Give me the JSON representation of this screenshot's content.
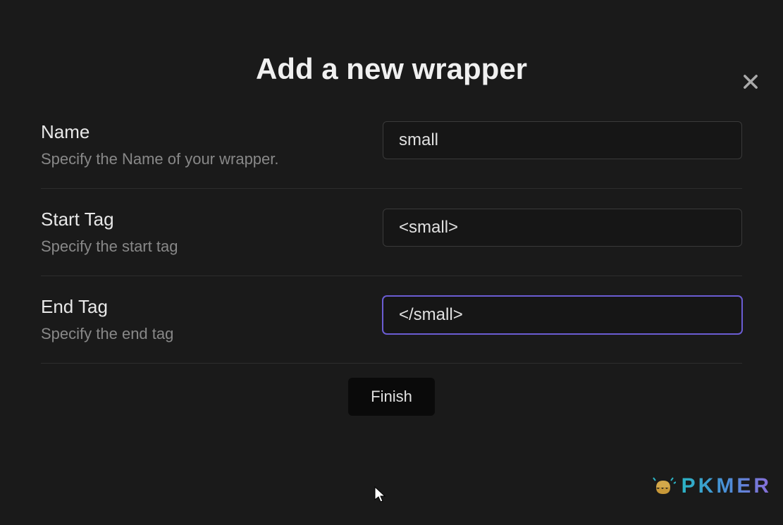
{
  "title": "Add a new wrapper",
  "fields": {
    "name": {
      "label": "Name",
      "description": "Specify the Name of your wrapper.",
      "value": "small"
    },
    "startTag": {
      "label": "Start Tag",
      "description": "Specify the start tag",
      "value": "<small>"
    },
    "endTag": {
      "label": "End Tag",
      "description": "Specify the end tag",
      "value": "</small>"
    }
  },
  "buttons": {
    "finish": "Finish"
  },
  "watermark": {
    "text": "PKMER"
  }
}
